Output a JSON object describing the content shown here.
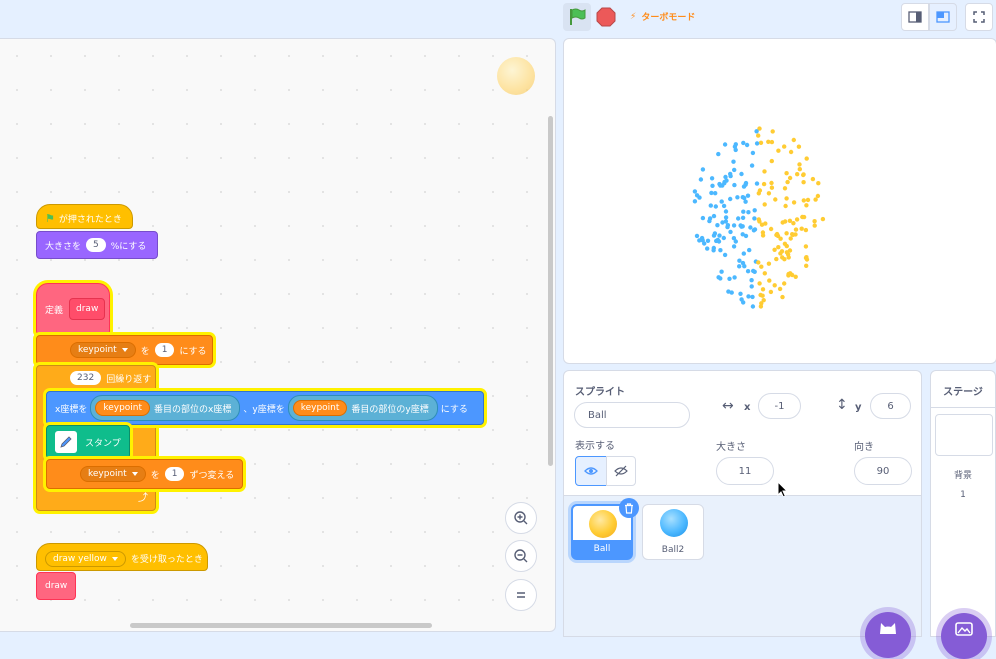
{
  "topbar": {
    "turbo_label": "ターボモード",
    "accent": "#ff8c1a"
  },
  "code": {
    "hat_green_flag": "が押されたとき",
    "size_block": {
      "prefix": "大きさを",
      "value": "5",
      "suffix": "%にする"
    },
    "define": {
      "label": "定義",
      "name": "draw"
    },
    "set_var": {
      "var": "keypoint",
      "mid": "を",
      "value": "1",
      "suffix": "にする"
    },
    "repeat": {
      "count": "232",
      "label": "回繰り返す"
    },
    "goto": {
      "x_prefix": "x座標を",
      "x_reporter_var": "keypoint",
      "x_reporter_text": "番目の部位のx座標",
      "sep": "、y座標を",
      "y_reporter_var": "keypoint",
      "y_reporter_text": "番目の部位のy座標",
      "suffix": "にする"
    },
    "stamp_label": "スタンプ",
    "change_var": {
      "var": "keypoint",
      "mid": "を",
      "value": "1",
      "suffix": "ずつ変える"
    },
    "receive": {
      "message": "draw yellow",
      "suffix": "を受け取ったとき"
    },
    "call_draw": "draw"
  },
  "sprite_panel": {
    "title": "スプライト",
    "name_value": "Ball",
    "x_label": "x",
    "x_value": "-1",
    "y_label": "y",
    "y_value": "6",
    "show_label": "表示する",
    "size_label": "大きさ",
    "size_value": "11",
    "direction_label": "向き",
    "direction_value": "90"
  },
  "sprites": [
    {
      "name": "Ball",
      "selected": true,
      "color": "#ffbf00"
    },
    {
      "name": "Ball2",
      "selected": false,
      "color": "#4cb8ff"
    }
  ],
  "stage_panel": {
    "title": "ステージ",
    "backdrop_label": "背景",
    "backdrop_count": "1"
  },
  "colors": {
    "blue_points": "#4cb8ff",
    "yellow_points": "#ffcc33",
    "selection": "#855cd6"
  }
}
